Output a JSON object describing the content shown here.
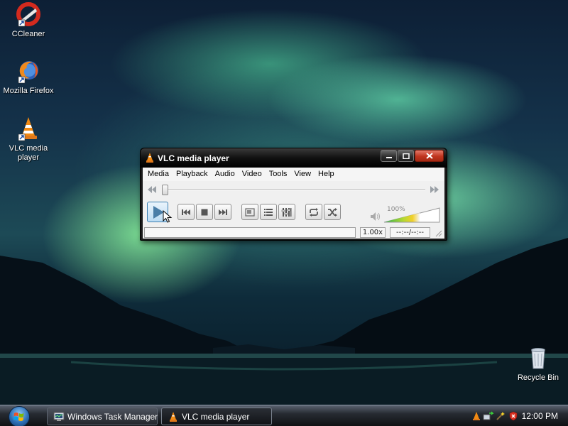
{
  "desktop": {
    "icons": [
      {
        "label": "CCleaner"
      },
      {
        "label": "Mozilla Firefox"
      },
      {
        "label": "VLC media player"
      },
      {
        "label": "Recycle Bin"
      }
    ]
  },
  "vlc": {
    "title": "VLC media player",
    "menu": [
      "Media",
      "Playback",
      "Audio",
      "Video",
      "Tools",
      "View",
      "Help"
    ],
    "volume_pct": "100%",
    "speed": "1.00x",
    "time": "--:--/--:--",
    "status_text": ""
  },
  "taskbar": {
    "tasks": [
      {
        "label": "Windows Task Manager"
      },
      {
        "label": "VLC media player"
      }
    ],
    "clock": "12:00 PM"
  }
}
